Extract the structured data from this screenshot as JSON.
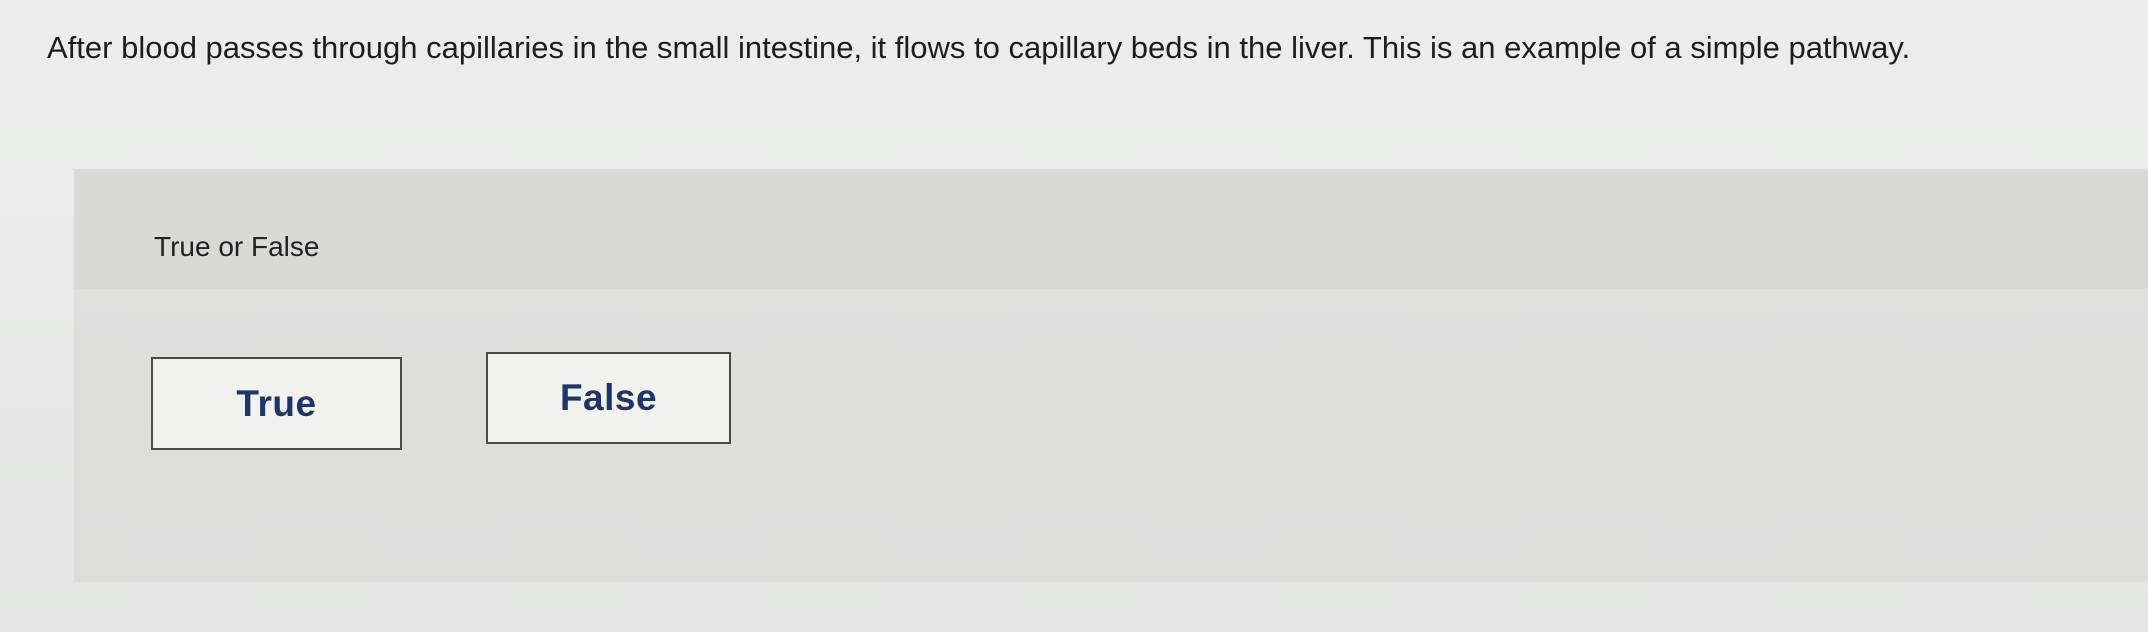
{
  "question": {
    "text": "After blood passes through capillaries in the small intestine, it flows to capillary beds in the liver. This is an example of a simple pathway."
  },
  "answer_panel": {
    "prompt": "True or False",
    "options": [
      {
        "label": "True"
      },
      {
        "label": "False"
      }
    ]
  },
  "colors": {
    "option_text": "#1f3566",
    "option_border": "#4a4a4a",
    "panel_background": "#dcdcdb"
  }
}
